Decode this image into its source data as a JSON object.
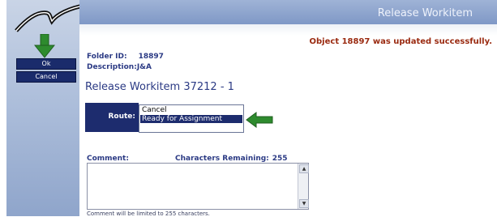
{
  "sidebar": {
    "logo_icon": "checkmark-swoosh-logo",
    "annotation_arrow_icon": "green-down-arrow-icon",
    "ok_label": "Ok",
    "cancel_label": "Cancel"
  },
  "header": {
    "title": "Release Workitem"
  },
  "status": {
    "message": "Object 18897 was updated successfully."
  },
  "details": {
    "folder_label": "Folder ID:",
    "folder_value": "18897",
    "description_label": "Description:",
    "description_value": "J&A"
  },
  "page_title": "Release Workitem 37212 - 1",
  "route": {
    "label": "Route:",
    "options": [
      "Cancel",
      "Ready for Assignment"
    ],
    "selected": "Ready for Assignment",
    "annotation_arrow_icon": "green-left-arrow-icon"
  },
  "comment": {
    "label": "Comment:",
    "chars_remaining_label": "Characters Remaining:",
    "chars_remaining_value": "255",
    "value": "",
    "limit_note": "Comment will be limited to 255 characters."
  },
  "colors": {
    "navy": "#1d2c6e",
    "status_red": "#9a2a10",
    "arrow_green": "#2e8b2e"
  }
}
